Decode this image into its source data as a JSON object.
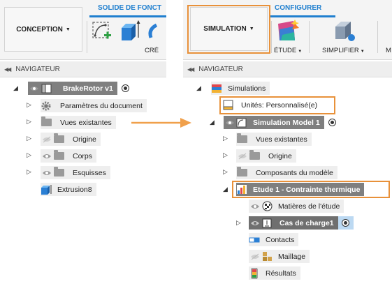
{
  "left": {
    "toolbar": {
      "workspace_label": "CONCEPTION",
      "tab_label": "SOLIDE DE FONCT",
      "tool_label": "CRÉ"
    },
    "navigator_label": "NAVIGATEUR",
    "tree": {
      "root": "BrakeRotor v1",
      "doc_settings": "Paramètres du document",
      "views": "Vues existantes",
      "origin": "Origine",
      "bodies": "Corps",
      "sketches": "Esquisses",
      "extrusion": "Extrusion8"
    }
  },
  "right": {
    "toolbar": {
      "workspace_label": "SIMULATION",
      "tab_label": "CONFIGURER",
      "study_label": "ÉTUDE",
      "simplify_label": "SIMPLIFIER",
      "cut_label": "M"
    },
    "navigator_label": "NAVIGATEUR",
    "tree": {
      "simulations": "Simulations",
      "units": "Unités: Personnalisé(e)",
      "model": "Simulation Model 1",
      "views": "Vues existantes",
      "origin": "Origine",
      "components": "Composants du modèle",
      "study": "Etude 1 - Contrainte thermique",
      "materials": "Matières de l'étude",
      "load_case": "Cas de charge1",
      "contacts": "Contacts",
      "mesh": "Maillage",
      "results": "Résultats"
    }
  },
  "colors": {
    "accent_blue": "#1f7fcf",
    "highlight_orange": "#e8913a",
    "arrow_orange": "#f0a04b",
    "selected_gray": "#7f7f7f"
  }
}
